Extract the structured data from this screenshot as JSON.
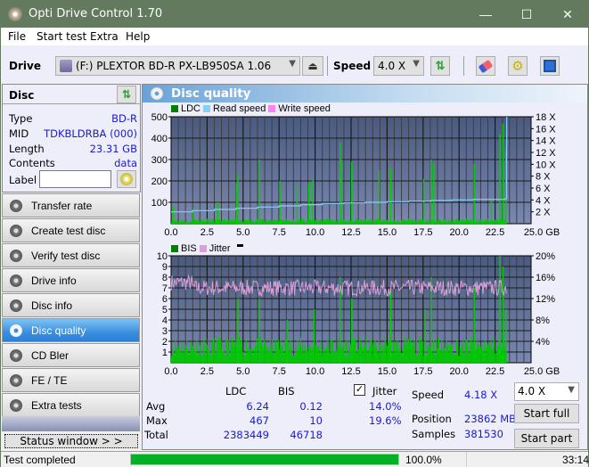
{
  "window": {
    "title": "Opti Drive Control 1.70",
    "minimize": "—",
    "maximize": "☐",
    "close": "✕"
  },
  "menu": [
    "File",
    "Start test",
    "Extra",
    "Help"
  ],
  "toolbar": {
    "drive_label": "Drive",
    "drive_value": "(F:)  PLEXTOR BD-R  PX-LB950SA 1.06",
    "speed_label": "Speed",
    "speed_value": "4.0 X"
  },
  "disc": {
    "header": "Disc",
    "rows": [
      {
        "key": "Type",
        "value": "BD-R"
      },
      {
        "key": "MID",
        "value": "TDKBLDRBA (000)"
      },
      {
        "key": "Length",
        "value": "23.31 GB"
      },
      {
        "key": "Contents",
        "value": "data"
      }
    ],
    "label_key": "Label",
    "label_value": ""
  },
  "nav": [
    {
      "label": "Transfer rate",
      "active": false
    },
    {
      "label": "Create test disc",
      "active": false
    },
    {
      "label": "Verify test disc",
      "active": false
    },
    {
      "label": "Drive info",
      "active": false
    },
    {
      "label": "Disc info",
      "active": false
    },
    {
      "label": "Disc quality",
      "active": true
    },
    {
      "label": "CD Bler",
      "active": false
    },
    {
      "label": "FE / TE",
      "active": false
    },
    {
      "label": "Extra tests",
      "active": false
    }
  ],
  "status_window_button": "Status window > >",
  "main": {
    "title": "Disc quality"
  },
  "chart_data": [
    {
      "type": "bar",
      "title": "LDC / Read speed",
      "legend": [
        "LDC",
        "Read speed",
        "Write speed"
      ],
      "legend_colors": [
        "#008000",
        "#87cefa",
        "#ff80ff"
      ],
      "xlabel": "GB",
      "x_ticks": [
        "0.0",
        "2.5",
        "5.0",
        "7.5",
        "10.0",
        "12.5",
        "15.0",
        "17.5",
        "20.0",
        "22.5",
        "25.0 GB"
      ],
      "xlim": [
        0,
        25
      ],
      "y_left_ticks": [
        "100",
        "200",
        "300",
        "400",
        "500"
      ],
      "ylim_left": [
        0,
        500
      ],
      "y_right_ticks": [
        "2 X",
        "4 X",
        "6 X",
        "8 X",
        "10 X",
        "12 X",
        "14 X",
        "16 X",
        "18 X"
      ],
      "ylim_right": [
        0,
        18
      ],
      "ldc_peaks": [
        [
          0.1,
          80
        ],
        [
          1.5,
          70
        ],
        [
          3.2,
          100
        ],
        [
          4.6,
          230
        ],
        [
          4.5,
          190
        ],
        [
          6.1,
          300
        ],
        [
          7.5,
          200
        ],
        [
          8.7,
          180
        ],
        [
          9.5,
          190
        ],
        [
          9.8,
          210
        ],
        [
          11.7,
          380
        ],
        [
          11.8,
          300
        ],
        [
          12.5,
          290
        ],
        [
          14.4,
          250
        ],
        [
          15.2,
          260
        ],
        [
          17.5,
          210
        ],
        [
          18.0,
          300
        ],
        [
          18.2,
          280
        ],
        [
          21.0,
          280
        ],
        [
          22.2,
          115
        ],
        [
          22.8,
          420
        ],
        [
          23.0,
          467
        ],
        [
          23.2,
          340
        ]
      ],
      "ldc_baseline": 20,
      "read_speed": [
        [
          0,
          2.0
        ],
        [
          1.5,
          2.2
        ],
        [
          3,
          2.4
        ],
        [
          4.5,
          2.6
        ],
        [
          6,
          2.8
        ],
        [
          7.5,
          3.0
        ],
        [
          9,
          3.2
        ],
        [
          10.5,
          3.4
        ],
        [
          12,
          3.5
        ],
        [
          13.5,
          3.6
        ],
        [
          15,
          3.7
        ],
        [
          16.5,
          3.8
        ],
        [
          18,
          3.9
        ],
        [
          19.5,
          4.0
        ],
        [
          21,
          4.1
        ],
        [
          23.2,
          4.2
        ],
        [
          23.3,
          13.0
        ],
        [
          23.31,
          18
        ]
      ]
    },
    {
      "type": "bar",
      "title": "BIS / Jitter",
      "legend": [
        "BIS",
        "Jitter"
      ],
      "legend_colors": [
        "#008000",
        "#d8a0d8"
      ],
      "xlabel": "GB",
      "x_ticks": [
        "0.0",
        "2.5",
        "5.0",
        "7.5",
        "10.0",
        "12.5",
        "15.0",
        "17.5",
        "20.0",
        "22.5",
        "25.0 GB"
      ],
      "xlim": [
        0,
        25
      ],
      "y_left_ticks": [
        "1",
        "2",
        "3",
        "4",
        "5",
        "6",
        "7",
        "8",
        "9",
        "10"
      ],
      "ylim_left": [
        0,
        10
      ],
      "y_right_ticks": [
        "4%",
        "8%",
        "12%",
        "16%",
        "20%"
      ],
      "ylim_right": [
        0,
        20
      ],
      "bis_peaks": [
        [
          4.6,
          6
        ],
        [
          6.1,
          6
        ],
        [
          8.0,
          4
        ],
        [
          9.9,
          5
        ],
        [
          11.7,
          8
        ],
        [
          12.5,
          6
        ],
        [
          15.2,
          7
        ],
        [
          17.6,
          5
        ],
        [
          18.0,
          8
        ],
        [
          21.0,
          7
        ],
        [
          22.8,
          10
        ],
        [
          23.0,
          9
        ],
        [
          23.2,
          5
        ]
      ],
      "bis_baseline": 2,
      "jitter_mean_pct": 14.0,
      "jitter_end_pct": 19.6
    }
  ],
  "stats": {
    "col_ldc": "LDC",
    "col_bis": "BIS",
    "rows": [
      {
        "label": "Avg",
        "ldc": "6.24",
        "bis": "0.12",
        "jitter": "14.0%"
      },
      {
        "label": "Max",
        "ldc": "467",
        "bis": "10",
        "jitter": "19.6%"
      },
      {
        "label": "Total",
        "ldc": "2383449",
        "bis": "46718"
      }
    ],
    "jitter_label": "Jitter",
    "jitter_checked": true,
    "speed_label": "Speed",
    "speed_value": "4.18 X",
    "position_label": "Position",
    "position_value": "23862 MB",
    "samples_label": "Samples",
    "samples_value": "381530",
    "speed_select": "4.0 X",
    "start_full": "Start full",
    "start_part": "Start part"
  },
  "statusbar": {
    "text": "Test completed",
    "progress_pct": 100.0,
    "progress_text": "100.0%",
    "time": "33:14"
  }
}
